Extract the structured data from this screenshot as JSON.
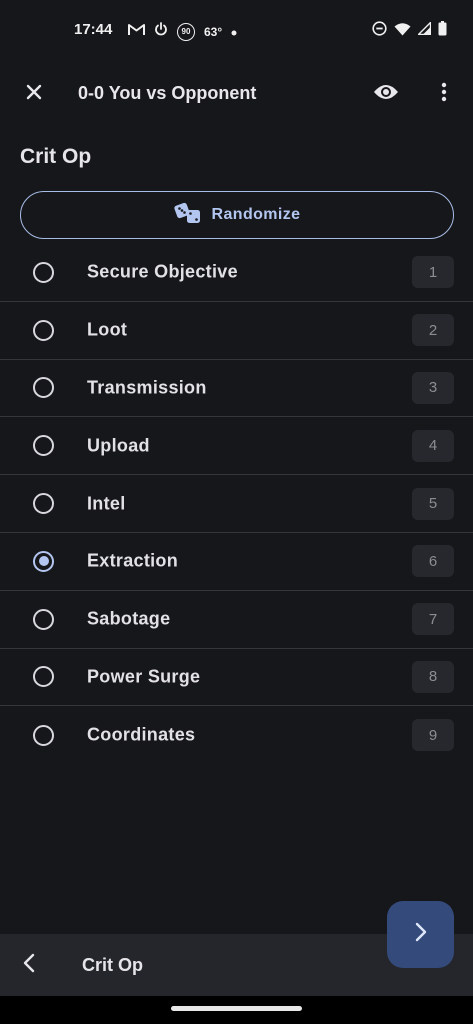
{
  "status_bar": {
    "time": "17:44",
    "temperature": "63°",
    "badge_number": "90",
    "icons": [
      "gmail-icon",
      "power-icon",
      "badge-90-icon",
      "dot-icon",
      "do-not-disturb-icon",
      "wifi-icon",
      "cell-signal-icon",
      "battery-icon"
    ]
  },
  "app_bar": {
    "title": "0-0 You vs Opponent",
    "close_icon": "close-icon",
    "view_icon": "eye-icon",
    "menu_icon": "more-vert-icon"
  },
  "section_title": "Crit Op",
  "randomize": {
    "label": "Randomize",
    "icon": "dice-icon"
  },
  "options": [
    {
      "label": "Secure Objective",
      "number": "1",
      "selected": false
    },
    {
      "label": "Loot",
      "number": "2",
      "selected": false
    },
    {
      "label": "Transmission",
      "number": "3",
      "selected": false
    },
    {
      "label": "Upload",
      "number": "4",
      "selected": false
    },
    {
      "label": "Intel",
      "number": "5",
      "selected": false
    },
    {
      "label": "Extraction",
      "number": "6",
      "selected": true
    },
    {
      "label": "Sabotage",
      "number": "7",
      "selected": false
    },
    {
      "label": "Power Surge",
      "number": "8",
      "selected": false
    },
    {
      "label": "Coordinates",
      "number": "9",
      "selected": false
    }
  ],
  "bottom_bar": {
    "title": "Crit Op",
    "back_icon": "chevron-left-icon"
  },
  "fab": {
    "icon": "chevron-right-icon"
  },
  "colors": {
    "background": "#16171b",
    "accent": "#b3c6f0",
    "fab": "#344a7a",
    "divider": "#35363b",
    "bottom_bar": "#25262b"
  }
}
